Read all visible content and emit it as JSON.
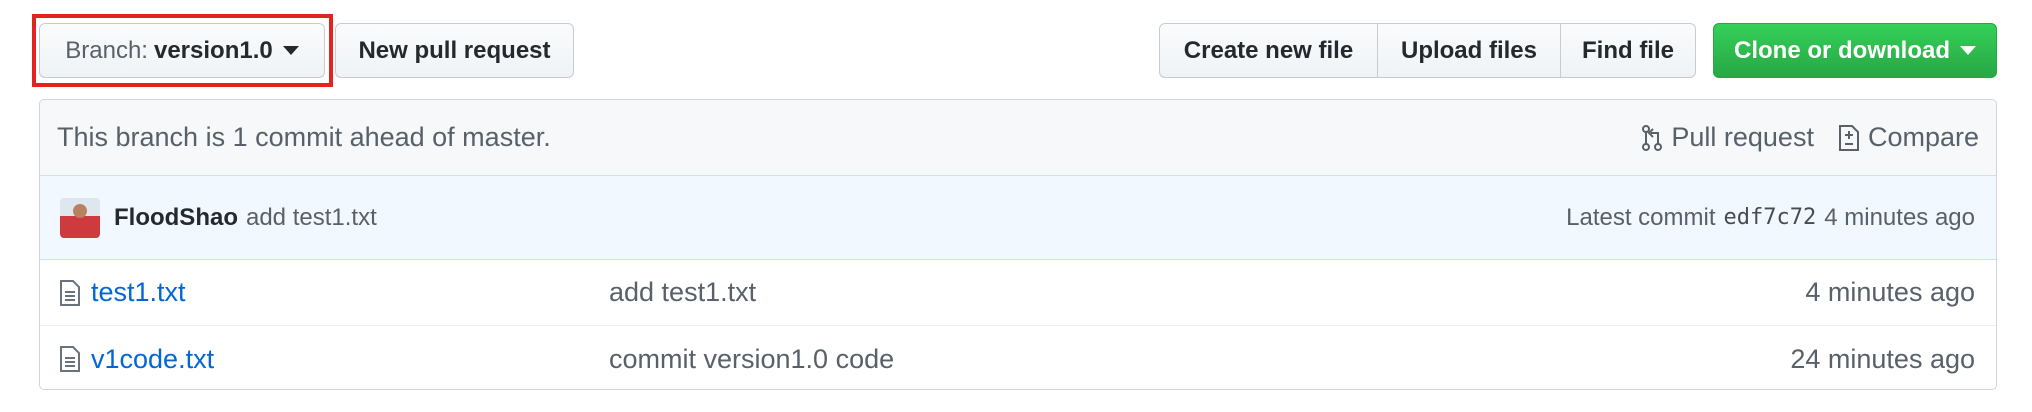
{
  "toolbar": {
    "branch_label": "Branch:",
    "branch_value": "version1.0",
    "new_pull_request": "New pull request",
    "create_new_file": "Create new file",
    "upload_files": "Upload files",
    "find_file": "Find file",
    "clone_or_download": "Clone or download"
  },
  "status": {
    "ahead_text": "This branch is 1 commit ahead of master.",
    "pull_request": "Pull request",
    "compare": "Compare"
  },
  "latest_commit": {
    "author": "FloodShao",
    "message": "add test1.txt",
    "label": "Latest commit",
    "sha": "edf7c72",
    "age": "4 minutes ago"
  },
  "files": [
    {
      "name": "test1.txt",
      "message": "add test1.txt",
      "age": "4 minutes ago",
      "icon": "file-icon"
    },
    {
      "name": "v1code.txt",
      "message": "commit version1.0 code",
      "age": "24 minutes ago",
      "icon": "file-icon"
    }
  ],
  "colors": {
    "highlight": "#e42320",
    "primary_green": "#28a745",
    "link_blue": "#0366d6",
    "commit_bg": "#f1f8ff"
  }
}
